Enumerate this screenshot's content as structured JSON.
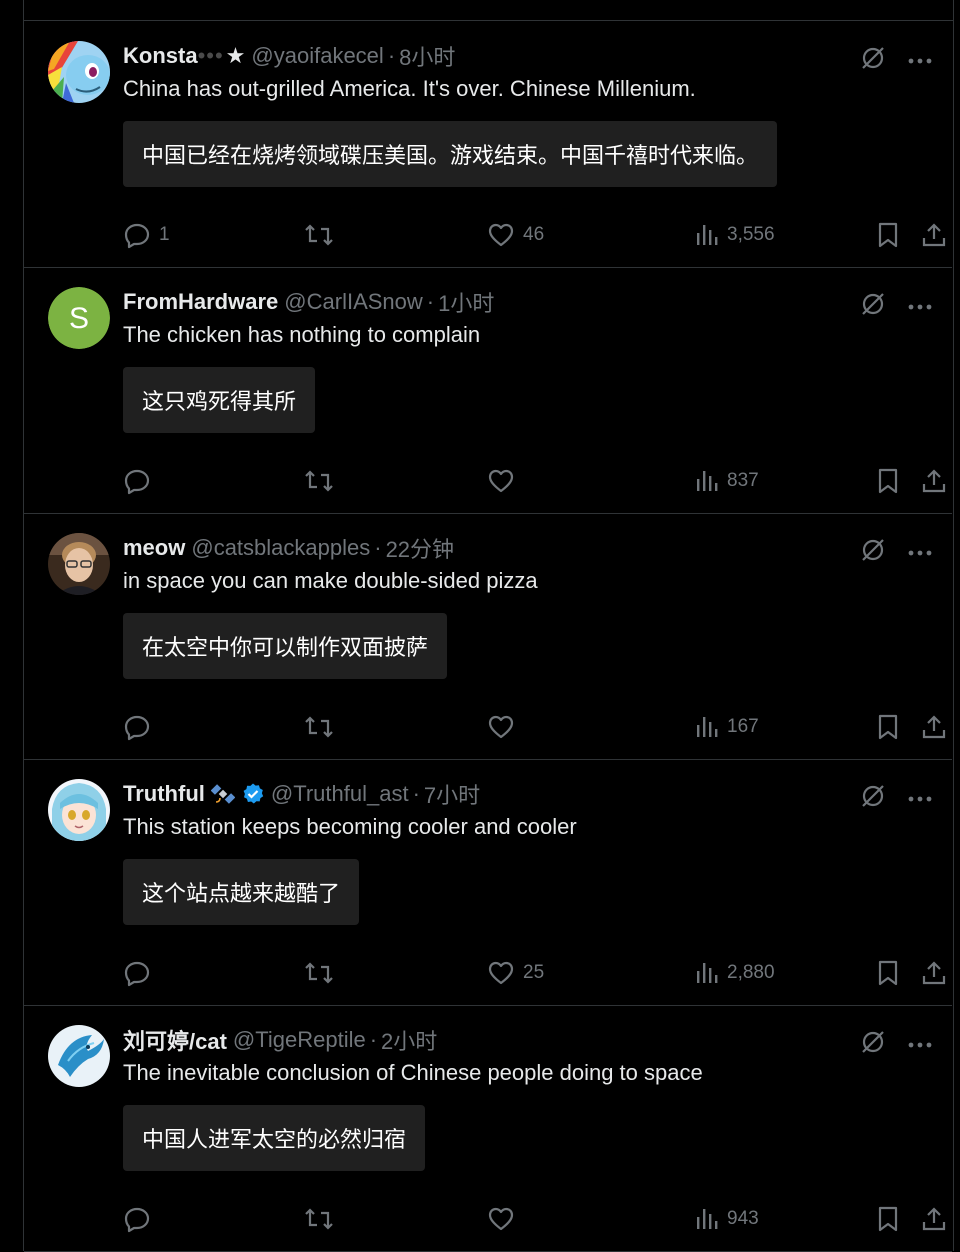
{
  "tweets": [
    {
      "name": "Konsta",
      "name_obscured": "•••",
      "name_suffix": "★",
      "handle": "@yaoifakecel",
      "time": "8小时",
      "text": "China has out-grilled America. It's over. Chinese Millenium.",
      "translation": "中国已经在烧烤领域碟压美国。游戏结束。中国千禧时代来临。",
      "replies": "1",
      "retweets": "",
      "likes": "46",
      "views": "3,556",
      "avatar": "pony-avatar"
    },
    {
      "name": "FromHardware",
      "handle": "@CarlIASnow",
      "time": "1小时",
      "text": "The chicken has nothing to complain",
      "translation": "这只鸡死得其所",
      "replies": "",
      "retweets": "",
      "likes": "",
      "views": "837",
      "avatar": "letter-avatar",
      "avatar_letter": "S",
      "avatar_color": "#7cb342"
    },
    {
      "name": "meow",
      "handle": "@catsblackapples",
      "time": "22分钟",
      "text": "in space you can make double-sided pizza",
      "translation": "在太空中你可以制作双面披萨",
      "replies": "",
      "retweets": "",
      "likes": "",
      "views": "167",
      "avatar": "photo-avatar"
    },
    {
      "name": "Truthful",
      "name_emoji": "satellite-emoji",
      "verified": true,
      "handle": "@Truthful_ast",
      "time": "7小时",
      "text": "This station keeps becoming cooler and cooler",
      "translation": "这个站点越来越酷了",
      "replies": "",
      "retweets": "",
      "likes": "25",
      "views": "2,880",
      "avatar": "anime-avatar"
    },
    {
      "name": "刘可婷/cat",
      "handle": "@TigeReptile",
      "time": "2小时",
      "text": "The inevitable conclusion of Chinese people doing to space",
      "translation": "中国人进军太空的必然归宿",
      "replies": "",
      "retweets": "",
      "likes": "",
      "views": "943",
      "avatar": "fish-avatar"
    }
  ],
  "icons": {
    "grok": "grok-icon",
    "more": "more-icon",
    "reply": "reply-icon",
    "retweet": "retweet-icon",
    "like": "like-icon",
    "views": "views-icon",
    "bookmark": "bookmark-icon",
    "share": "share-icon",
    "verified": "verified-badge-icon"
  },
  "colors": {
    "background": "#000000",
    "text": "#e7e9ea",
    "muted": "#71767b",
    "border": "#2f3336",
    "translation_bg": "#202020",
    "verified": "#1d9bf0"
  },
  "dot": "·"
}
